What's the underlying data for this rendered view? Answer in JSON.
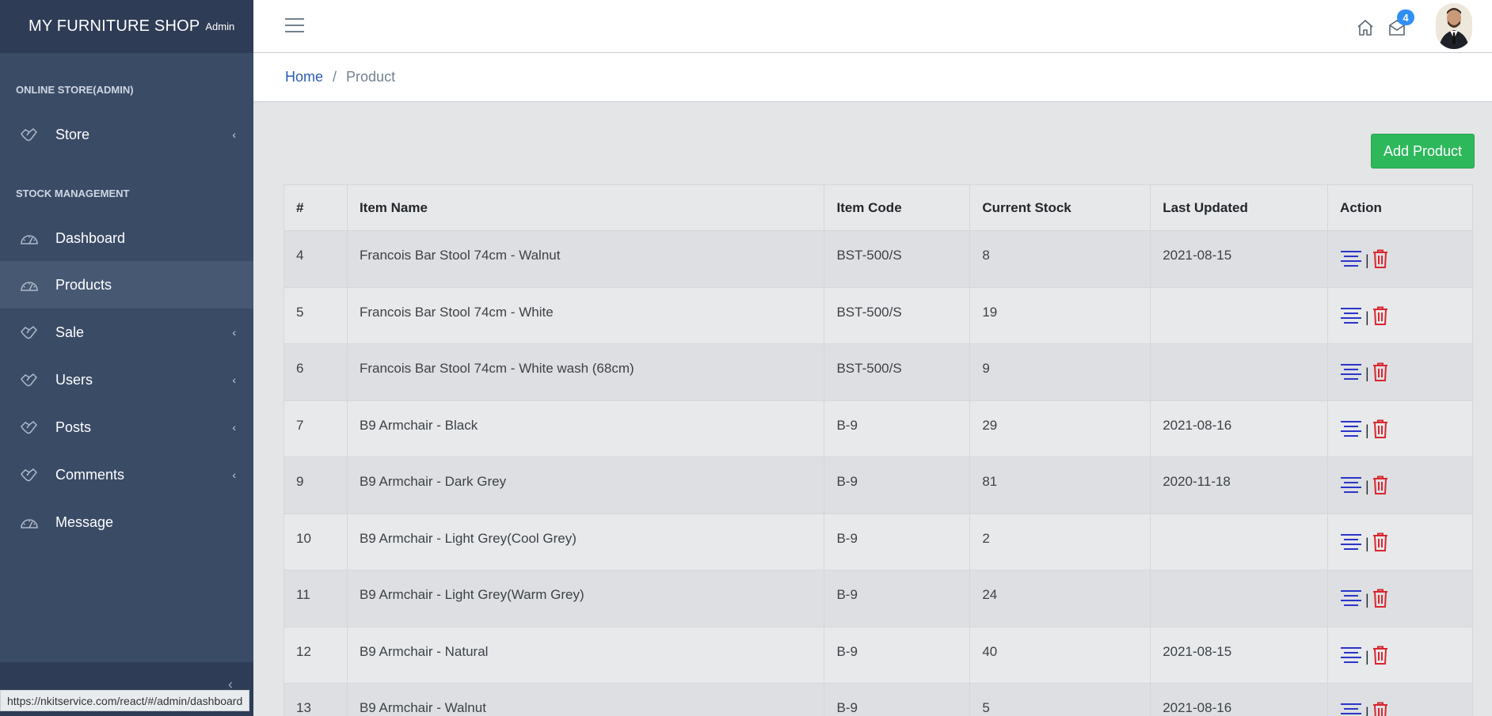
{
  "brand": {
    "title": "MY FURNITURE SHOP",
    "subtitle": "Admin"
  },
  "sidebar": {
    "section1": "ONLINE STORE(ADMIN)",
    "section2": "STOCK MANAGEMENT",
    "items": [
      {
        "label": "Store",
        "icon": "hand-icon",
        "caret": true
      },
      {
        "label": "Dashboard",
        "icon": "speedometer-icon",
        "caret": false
      },
      {
        "label": "Products",
        "icon": "speedometer-icon",
        "caret": false,
        "active": true
      },
      {
        "label": "Sale",
        "icon": "hand-icon",
        "caret": true
      },
      {
        "label": "Users",
        "icon": "hand-icon",
        "caret": true
      },
      {
        "label": "Posts",
        "icon": "hand-icon",
        "caret": true
      },
      {
        "label": "Comments",
        "icon": "hand-icon",
        "caret": true
      },
      {
        "label": "Message",
        "icon": "speedometer-icon",
        "caret": false
      }
    ],
    "caret_glyph": "‹",
    "minimizer_glyph": "‹"
  },
  "header": {
    "mail_badge": "4"
  },
  "breadcrumb": {
    "home": "Home",
    "separator": "/",
    "current": "Product"
  },
  "add_button": "Add Product",
  "table": {
    "headers": [
      "#",
      "Item Name",
      "Item Code",
      "Current Stock",
      "Last Updated",
      "Action"
    ],
    "rows": [
      {
        "id": "4",
        "name": "Francois Bar Stool 74cm - Walnut",
        "code": "BST-500/S",
        "stock": "8",
        "updated": "2021-08-15"
      },
      {
        "id": "5",
        "name": "Francois Bar Stool 74cm - White",
        "code": "BST-500/S",
        "stock": "19",
        "updated": ""
      },
      {
        "id": "6",
        "name": "Francois Bar Stool 74cm - White wash (68cm)",
        "code": "BST-500/S",
        "stock": "9",
        "updated": ""
      },
      {
        "id": "7",
        "name": "B9 Armchair - Black",
        "code": "B-9",
        "stock": "29",
        "updated": "2021-08-16"
      },
      {
        "id": "9",
        "name": "B9 Armchair - Dark Grey",
        "code": "B-9",
        "stock": "81",
        "updated": "2020-11-18"
      },
      {
        "id": "10",
        "name": "B9 Armchair - Light Grey(Cool Grey)",
        "code": "B-9",
        "stock": "2",
        "updated": ""
      },
      {
        "id": "11",
        "name": "B9 Armchair - Light Grey(Warm Grey)",
        "code": "B-9",
        "stock": "24",
        "updated": ""
      },
      {
        "id": "12",
        "name": "B9 Armchair - Natural",
        "code": "B-9",
        "stock": "40",
        "updated": "2021-08-15"
      },
      {
        "id": "13",
        "name": "B9 Armchair - Walnut",
        "code": "B-9",
        "stock": "5",
        "updated": "2021-08-16"
      }
    ],
    "action_separator": "|"
  },
  "status_url": "https://nkitservice.com/react/#/admin/dashboard",
  "colors": {
    "sidebar": "#3a4b66",
    "brand_bar": "#2f3c55",
    "add_button": "#2eb85c",
    "edit_icon": "#2b35c9",
    "delete_icon": "#d9262e",
    "badge": "#2f8ff3"
  }
}
